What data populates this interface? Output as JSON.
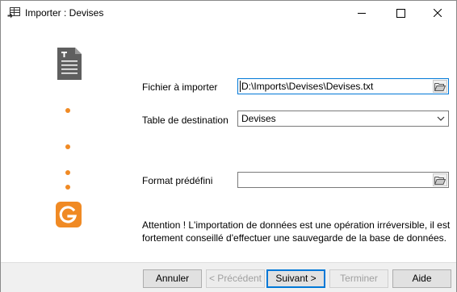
{
  "window": {
    "title": "Importer : Devises"
  },
  "form": {
    "file_label": "Fichier à importer",
    "file_value": "D:\\Imports\\Devises\\Devises.txt",
    "table_label": "Table de destination",
    "table_value": "Devises",
    "format_label": "Format prédéfini",
    "format_value": ""
  },
  "warning": "Attention ! L'importation de données est une opération irréversible, il est fortement conseillé d'effectuer une sauvegarde de la base de données.",
  "buttons": {
    "cancel": "Annuler",
    "previous": "< Précédent",
    "next": "Suivant >",
    "finish": "Terminer",
    "help": "Aide"
  },
  "colors": {
    "accent": "#f08a24",
    "focus": "#0078d7"
  },
  "icons": {
    "title": "import-table-icon",
    "step1": "text-document-icon",
    "step_last": "app-logo-icon",
    "browse": "folder-open-icon"
  }
}
